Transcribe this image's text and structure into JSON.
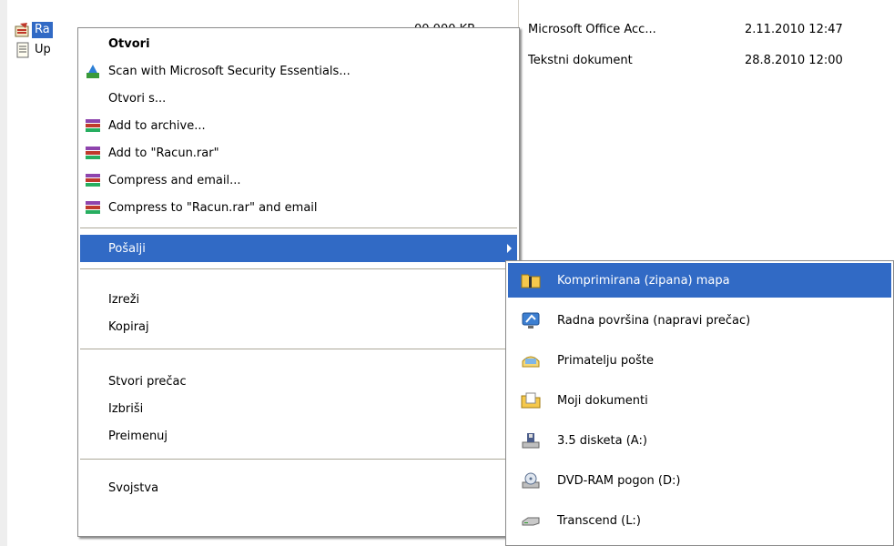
{
  "explorer": {
    "files": [
      {
        "name": "Ra",
        "size": "00 000 KB",
        "type": "Microsoft Office Acc...",
        "date": "2.11.2010 12:47",
        "icon": "access-database-icon"
      },
      {
        "name": "Up",
        "size": "",
        "type": "Tekstni dokument",
        "date": "28.8.2010 12:00",
        "icon": "text-document-icon"
      }
    ]
  },
  "context_menu": {
    "items": [
      {
        "label": "Otvori",
        "icon": "",
        "bold": true
      },
      {
        "label": "Scan with Microsoft Security Essentials...",
        "icon": "security-essentials-icon"
      },
      {
        "label": "Otvori s...",
        "icon": ""
      },
      {
        "label": "Add to archive...",
        "icon": "winrar-icon"
      },
      {
        "label": "Add to \"Racun.rar\"",
        "icon": "winrar-icon"
      },
      {
        "label": "Compress and email...",
        "icon": "winrar-icon"
      },
      {
        "label": "Compress to \"Racun.rar\" and email",
        "icon": "winrar-icon"
      },
      {
        "label": "Pošalji",
        "icon": "",
        "submenu": true
      },
      {
        "label": "Izreži",
        "icon": ""
      },
      {
        "label": "Kopiraj",
        "icon": ""
      },
      {
        "label": "Stvori prečac",
        "icon": ""
      },
      {
        "label": "Izbriši",
        "icon": ""
      },
      {
        "label": "Preimenuj",
        "icon": ""
      },
      {
        "label": "Svojstva",
        "icon": ""
      }
    ],
    "highlighted": "Pošalji"
  },
  "send_to_menu": {
    "items": [
      {
        "label": "Komprimirana (zipana) mapa",
        "icon": "zip-folder-icon"
      },
      {
        "label": "Radna površina (napravi prečac)",
        "icon": "desktop-icon"
      },
      {
        "label": "Primatelju pošte",
        "icon": "mail-recipient-icon"
      },
      {
        "label": "Moji dokumenti",
        "icon": "my-documents-icon"
      },
      {
        "label": "3.5 disketa (A:)",
        "icon": "floppy-drive-icon"
      },
      {
        "label": "DVD-RAM pogon (D:)",
        "icon": "dvd-drive-icon"
      },
      {
        "label": "Transcend (L:)",
        "icon": "removable-drive-icon"
      }
    ],
    "highlighted": "Komprimirana (zipana) mapa"
  },
  "colors": {
    "highlight": "#316ac5",
    "menu_bg": "#ffffff",
    "separator": "#aca899"
  }
}
